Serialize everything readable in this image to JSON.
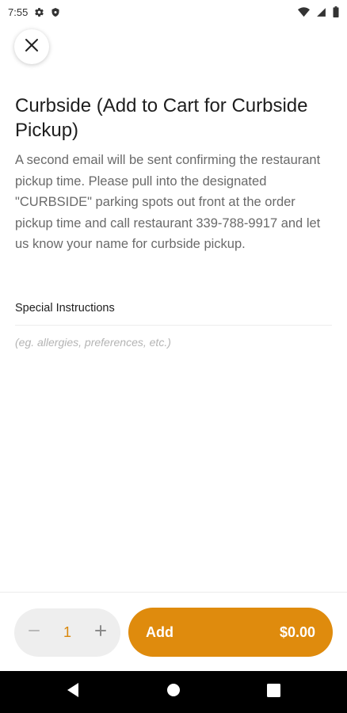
{
  "status_bar": {
    "time": "7:55",
    "left_icons": [
      "gear-icon",
      "shield-icon"
    ],
    "right_icons": [
      "wifi-icon",
      "signal-icon",
      "battery-icon"
    ]
  },
  "header": {
    "close_icon": "close-icon"
  },
  "item": {
    "title": "Curbside (Add to Cart for Curbside Pickup)",
    "description": "A second email will be sent confirming the restaurant pickup time.  Please pull into the designated \"CURBSIDE\" parking spots out front at the order pickup time and call restaurant 339-788-9917 and let us know your name for curbside pickup."
  },
  "special_instructions": {
    "label": "Special Instructions",
    "placeholder": "(eg. allergies, preferences, etc.)",
    "value": ""
  },
  "footer": {
    "quantity": "1",
    "decrement_icon": "minus-icon",
    "increment_icon": "plus-icon",
    "add_label": "Add",
    "price": "$0.00"
  },
  "nav": {
    "back_icon": "back-icon",
    "home_icon": "home-icon",
    "recents_icon": "recents-icon"
  },
  "colors": {
    "accent": "#df8b0d",
    "quantity_text": "#d9870b",
    "stepper_bg": "#eeeeee",
    "nav_bg": "#000000"
  }
}
